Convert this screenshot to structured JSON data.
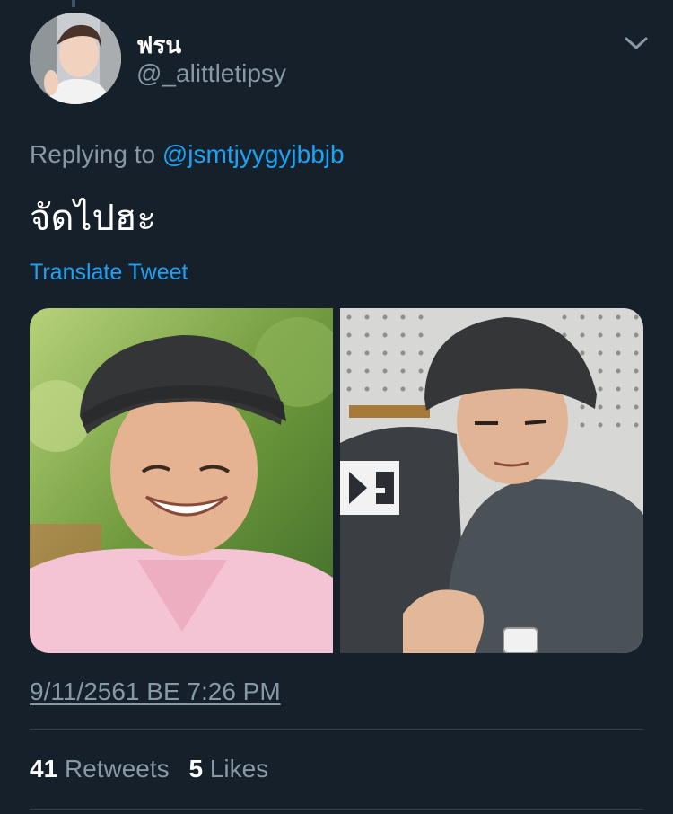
{
  "tweet": {
    "display_name": "ฟรน",
    "handle": "@_alittletipsy",
    "replying_prefix": "Replying to",
    "replying_to": "@jsmtjyygyjbbjb",
    "text": "จัดไปฮะ",
    "translate_label": "Translate Tweet",
    "timestamp": "9/11/2561 BE 7:26 PM",
    "retweets_count": "41",
    "retweets_label": "Retweets",
    "likes_count": "5",
    "likes_label": "Likes"
  },
  "media": {
    "left_photo_logo": "",
    "right_photo_logo": ""
  },
  "colors": {
    "background": "#15202b",
    "secondary_text": "#8899a6",
    "link": "#1da1f2",
    "divider": "#38444d"
  },
  "icons": {
    "menu": "chevron-down-icon"
  }
}
